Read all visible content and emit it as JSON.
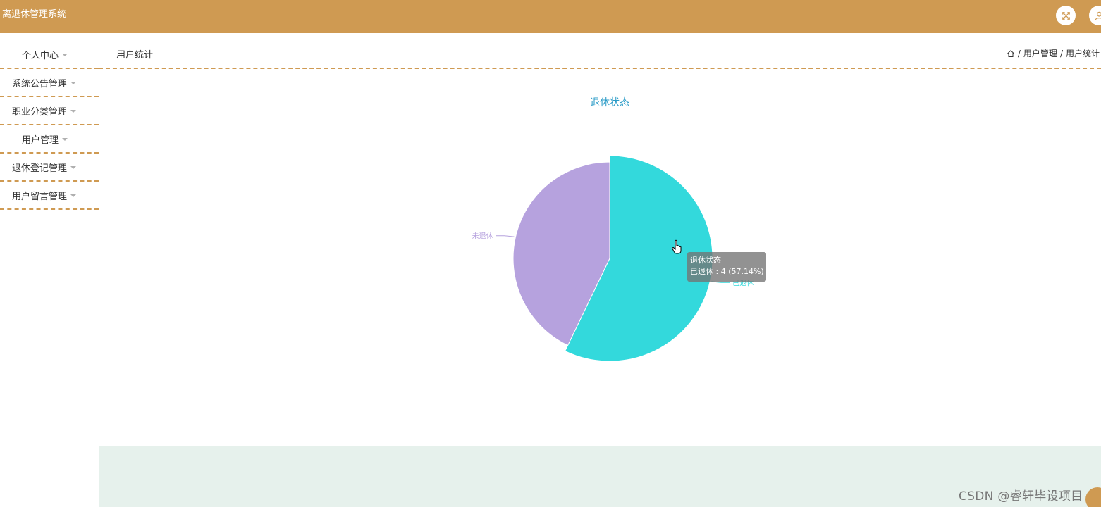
{
  "app": {
    "title": "离退休管理系统"
  },
  "header": {
    "fullscreen_icon": "fullscreen-icon",
    "user_icon": "user-icon"
  },
  "sidebar": {
    "items": [
      {
        "label": "个人中心"
      },
      {
        "label": "系统公告管理"
      },
      {
        "label": "职业分类管理"
      },
      {
        "label": "用户管理"
      },
      {
        "label": "退休登记管理"
      },
      {
        "label": "用户留言管理"
      }
    ]
  },
  "page": {
    "title": "用户统计",
    "breadcrumb": {
      "home_icon": "home-icon",
      "separator": "/",
      "items": [
        "用户管理",
        "用户统计"
      ]
    }
  },
  "chart_data": {
    "type": "pie",
    "title": "退休状态",
    "slices": [
      {
        "label": "已退休",
        "value": 4,
        "percent": 57.14,
        "color": "#33d9dc"
      },
      {
        "label": "未退休",
        "value": 3,
        "percent": 42.86,
        "color": "#b6a2de"
      }
    ],
    "emphasized": "已退休"
  },
  "tooltip": {
    "title": "退休状态",
    "line": "已退休 : 4 (57.14%)"
  },
  "watermark": {
    "text": "CSDN @睿轩毕设项目"
  },
  "colors": {
    "accent": "#cf9a52",
    "title": "#2a9bc7",
    "footer": "#e6f1ec"
  }
}
